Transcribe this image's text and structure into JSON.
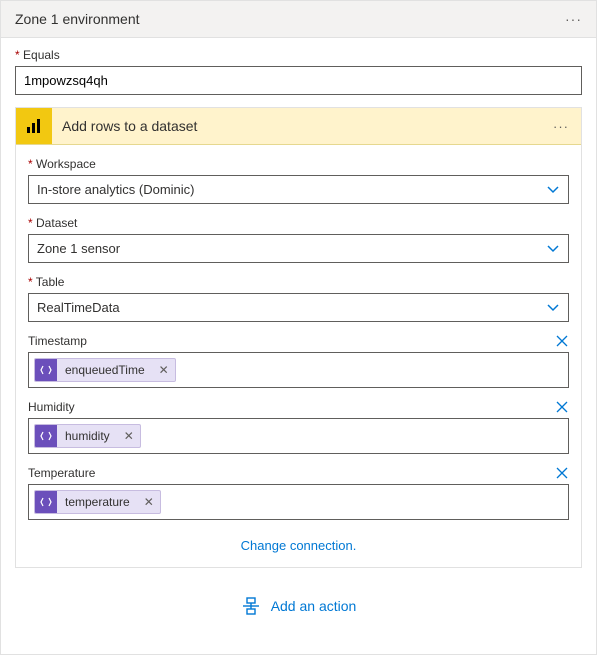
{
  "header": {
    "title": "Zone 1 environment"
  },
  "equals": {
    "label": "Equals",
    "value": "1mpowzsq4qh"
  },
  "action": {
    "title": "Add rows to a dataset",
    "icon": "powerbi-icon",
    "workspace": {
      "label": "Workspace",
      "value": "In-store analytics (Dominic)"
    },
    "dataset": {
      "label": "Dataset",
      "value": "Zone 1 sensor"
    },
    "table": {
      "label": "Table",
      "value": "RealTimeData"
    },
    "timestamp": {
      "label": "Timestamp",
      "token": "enqueuedTime"
    },
    "humidity": {
      "label": "Humidity",
      "token": "humidity"
    },
    "temperature": {
      "label": "Temperature",
      "token": "temperature"
    },
    "change_connection": "Change connection."
  },
  "footer": {
    "add_action": "Add an action"
  }
}
